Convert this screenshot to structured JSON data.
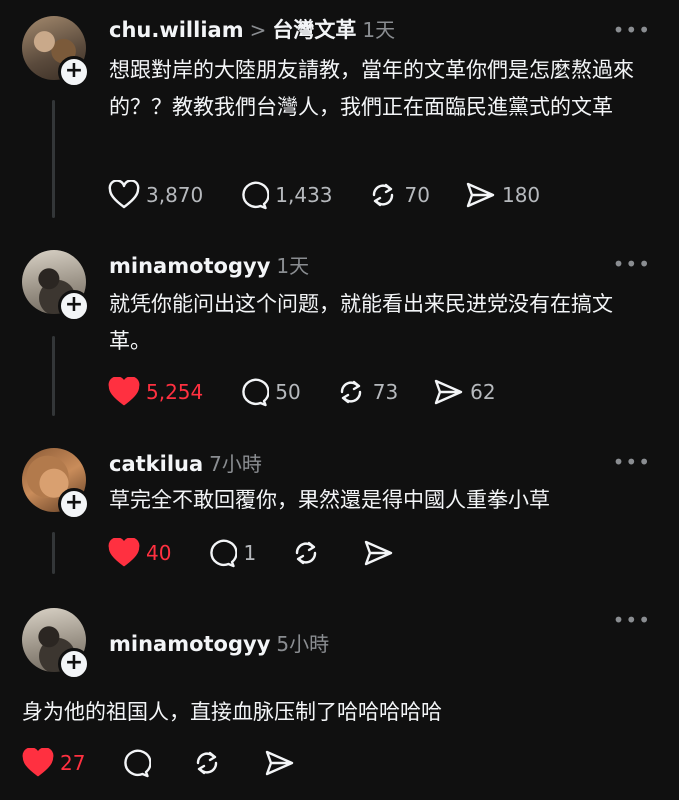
{
  "posts": [
    {
      "username": "chu.william",
      "topic": "台灣文革",
      "time": "1天",
      "text": "想跟對岸的大陸朋友請教，當年的文革你們是怎麼熬過來的？？教教我們台灣人，我們正在面臨民進黨式的文革",
      "likes": "3,870",
      "replies": "1,433",
      "reposts": "70",
      "shares": "180",
      "liked": false
    },
    {
      "username": "minamotogyy",
      "time": "1天",
      "text": "就凭你能问出这个问题，就能看出来民进党没有在搞文革。",
      "likes": "5,254",
      "replies": "50",
      "reposts": "73",
      "shares": "62",
      "liked": true
    },
    {
      "username": "catkilua",
      "time": "7小時",
      "text": "草完全不敢回覆你，果然還是得中國人重拳小草",
      "likes": "40",
      "replies": "1",
      "liked": true
    },
    {
      "username": "minamotogyy",
      "time": "5小時",
      "text": "身为他的祖国人，直接血脉压制了哈哈哈哈哈",
      "likes": "27",
      "liked": true
    }
  ],
  "icons": {
    "more": "more-icon",
    "like": "heart-icon",
    "reply": "comment-icon",
    "repost": "repost-icon",
    "share": "share-icon",
    "follow": "plus-icon",
    "chevron": "chevron-right-icon"
  },
  "colors": {
    "background": "#101010",
    "liked": "#ff3040",
    "muted": "#8a8d91"
  },
  "more_label": "•••",
  "chevron_label": ">",
  "plus_label": "+"
}
